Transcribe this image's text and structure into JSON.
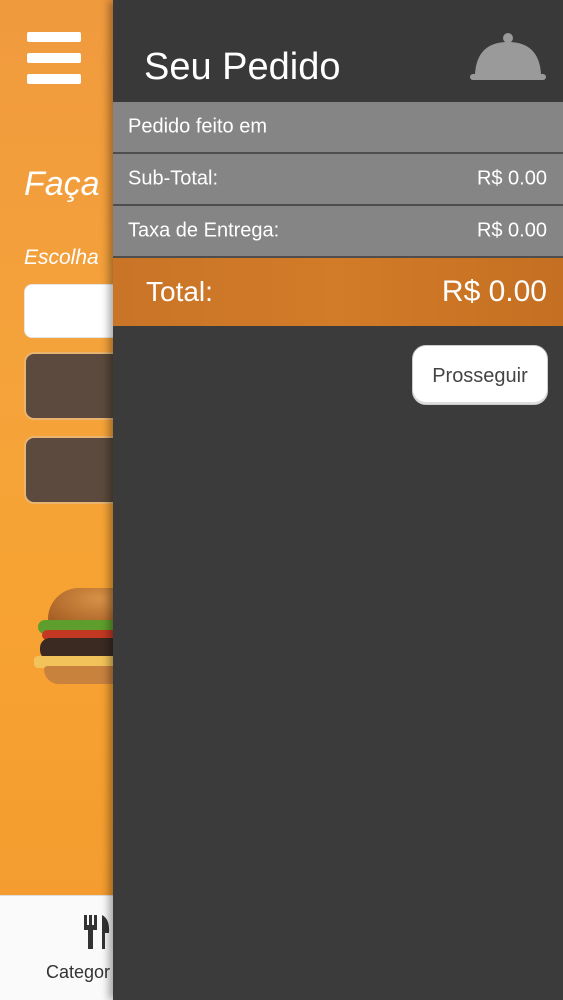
{
  "background": {
    "title": "Faça",
    "subtitle": "Escolha",
    "bottom_nav": {
      "label": "Categor"
    },
    "icons": {
      "menu": "hamburger-icon",
      "category": "fork-knife-icon",
      "image": "burger-image"
    }
  },
  "drawer": {
    "title": "Seu Pedido",
    "icon": "cloche-icon",
    "order_made_label": "Pedido feito em",
    "subtotal": {
      "label": "Sub-Total:",
      "value": "R$ 0.00"
    },
    "delivery_fee": {
      "label": "Taxa de Entrega:",
      "value": "R$ 0.00"
    },
    "total": {
      "label": "Total:",
      "value": "R$ 0.00"
    },
    "proceed_label": "Prosseguir"
  },
  "colors": {
    "accent": "#d27b28",
    "drawer_bg": "#3b3b3b",
    "row_bg": "#858585",
    "bg_orange": "#f5a33a"
  }
}
